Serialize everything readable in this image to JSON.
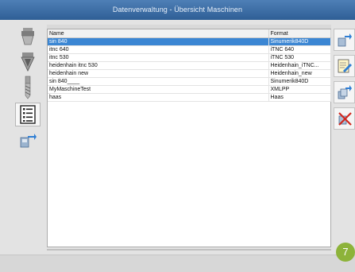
{
  "window": {
    "title": "Datenverwaltung - Übersicht Maschinen"
  },
  "left_toolbar": {
    "items": [
      {
        "icon": "tool-holder-icon"
      },
      {
        "icon": "milling-head-icon"
      },
      {
        "icon": "drill-bit-icon"
      },
      {
        "icon": "machine-list-icon",
        "active": true
      },
      {
        "icon": "machine-transfer-icon"
      }
    ]
  },
  "right_toolbar": {
    "items": [
      {
        "icon": "add-machine-icon"
      },
      {
        "icon": "edit-machine-icon"
      },
      {
        "icon": "copy-machine-icon"
      },
      {
        "icon": "delete-machine-icon"
      }
    ]
  },
  "table": {
    "columns": [
      "Name",
      "Format"
    ],
    "rows": [
      {
        "name": "sin 840",
        "format": "Sinumerik840D",
        "selected": true
      },
      {
        "name": "itnc 640",
        "format": "iTNC 640"
      },
      {
        "name": "itnc 530",
        "format": "iTNC 530"
      },
      {
        "name": "heidenhain itnc 530",
        "format": "Heidenhain_iTNC..."
      },
      {
        "name": "heidenhain new",
        "format": "Heidenhain_new"
      },
      {
        "name": "sin 840____",
        "format": "Sinumerik840D"
      },
      {
        "name": "MyMaschineTest",
        "format": "XMLPP"
      },
      {
        "name": "haas",
        "format": "Haas"
      }
    ]
  },
  "page_badge": "7",
  "colors": {
    "titlebar": "#3e6ea6",
    "selection": "#3b86d3",
    "badge": "#8db33a"
  }
}
